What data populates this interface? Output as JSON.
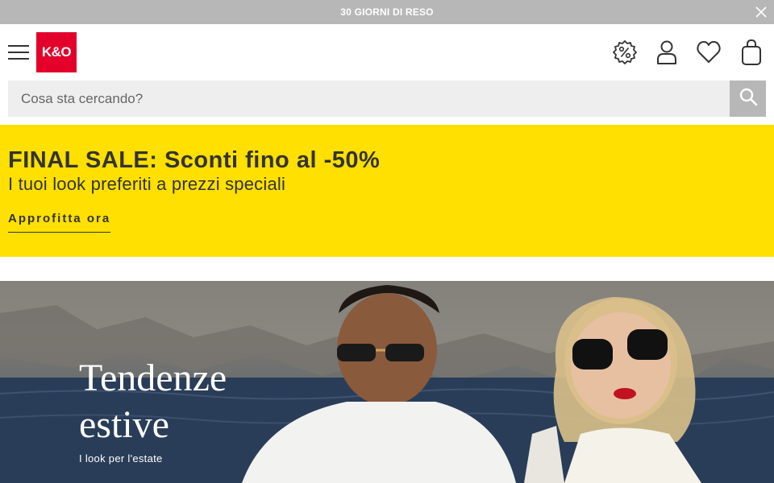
{
  "announcement": {
    "text": "30 GIORNI DI RESO"
  },
  "header": {
    "logo_text": "K&O"
  },
  "search": {
    "placeholder": "Cosa sta cercando?"
  },
  "promo": {
    "title": "FINAL SALE: Sconti fino al -50%",
    "subtitle": "I tuoi look preferiti a prezzi speciali",
    "cta": "Approfitta ora",
    "background": "#ffe000"
  },
  "hero": {
    "title_line1": "Tendenze",
    "title_line2": "estive",
    "subtitle": "I look per l'estate"
  },
  "colors": {
    "brand": "#e3002b",
    "announcement_bg": "#b7b7b7",
    "text": "#333333"
  },
  "icons": [
    "close-icon",
    "menu-icon",
    "discount-icon",
    "user-icon",
    "heart-icon",
    "bag-icon",
    "search-icon"
  ]
}
